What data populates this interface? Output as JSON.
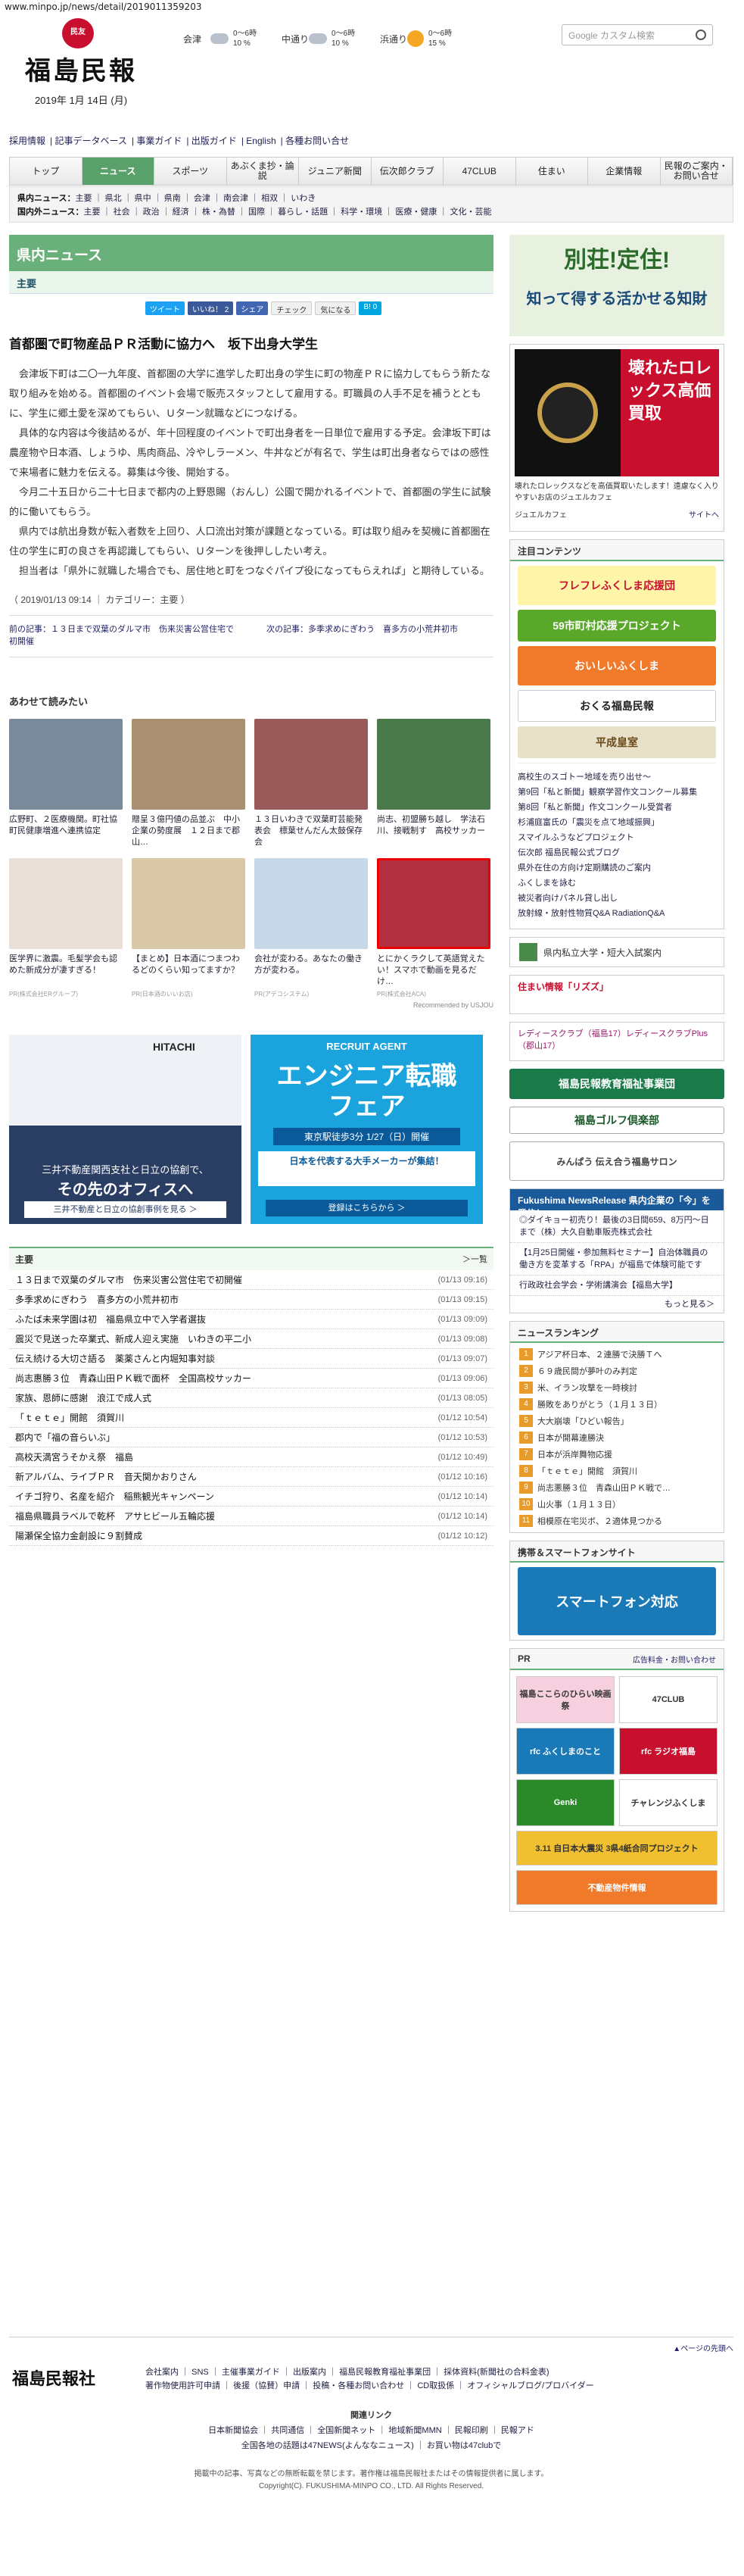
{
  "url": "www.minpo.jp/news/detail/2019011359203",
  "logo": {
    "seal": "民友",
    "name": "福島民報",
    "date": "2019年 1月 14日 (月)"
  },
  "weather": [
    {
      "city": "会津",
      "r1": "0〜6時",
      "p1": "10 %",
      "icon": "cloud"
    },
    {
      "city": "中通り",
      "r1": "0〜6時",
      "p1": "10 %",
      "icon": "cloud"
    },
    {
      "city": "浜通り",
      "r1": "0〜6時",
      "p1": "15 %",
      "icon": "sun"
    }
  ],
  "search": {
    "placeholder": "Google カスタム検索"
  },
  "topnav": [
    "採用情報",
    "記事データベース",
    "事業ガイド",
    "出版ガイド",
    "English",
    "各種お問い合せ"
  ],
  "gnav": [
    "トップ",
    "ニュース",
    "スポーツ",
    "あぶくま抄・論説",
    "ジュニア新聞",
    "伝次郎クラブ",
    "47CLUB",
    "住まい",
    "企業情報",
    "民報のご案内・お問い合せ"
  ],
  "subnav": {
    "l1_label": "県内ニュース：",
    "l1": "主要 ｜ 県北 ｜ 県中 ｜ 県南 ｜ 会津 ｜ 南会津 ｜ 相双 ｜ いわき",
    "l2_label": "国内外ニュース：",
    "l2": "主要 ｜ 社会 ｜ 政治 ｜ 経済 ｜ 株・為替 ｜ 国際 ｜ 暮らし・話題 ｜ 科学・環境 ｜ 医療・健康 ｜ 文化・芸能"
  },
  "main": {
    "section": "県内ニュース",
    "subsection": "主要",
    "social": [
      "ツイート",
      "いいね！ 2",
      "シェア",
      "チェック",
      "気になる",
      "B! 0"
    ],
    "title": "首都圏で町物産品ＰＲ活動に協力へ　坂下出身大学生",
    "paragraphs": [
      "会津坂下町は二〇一九年度、首都圏の大学に進学した町出身の学生に町の物産ＰＲに協力してもらう新たな取り組みを始める。首都圏のイベント会場で販売スタッフとして雇用する。町職員の人手不足を補うとともに、学生に郷土愛を深めてもらい、Ｕターン就職などにつなげる。",
      "具体的な内容は今後詰めるが、年十回程度のイベントで町出身者を一日単位で雇用する予定。会津坂下町は農産物や日本酒、しょうゆ、馬肉商品、冷やしラーメン、牛丼などが有名で、学生は町出身者ならではの感性で来場者に魅力を伝える。募集は今後、開始する。",
      "今月二十五日から二十七日まで都内の上野恩賜（おんし）公園で開かれるイベントで、首都圏の学生に試験的に働いてもらう。",
      "県内では航出身数が転入者数を上回り、人口流出対策が課題となっている。町は取り組みを契機に首都圏在住の学生に町の良さを再認識してもらい、Ｕターンを後押ししたい考え。",
      "担当者は「県外に就職した場合でも、居住地と町をつなぐパイプ役になってもらえれば」と期待している。"
    ],
    "meta": "（ 2019/01/13 09:14 ｜ カテゴリー：主要 ）",
    "prev": "前の記事：１３日まで双葉のダルマ市　伤来災害公営住宅で初開催",
    "next": "次の記事：多季求めにぎわう　喜多方の小荒井初市",
    "related_title": "あわせて読みたい",
    "related": [
      {
        "cap": "広野町、２医療機関。町社協　町民健康増進へ連携協定",
        "src": "",
        "c": "#7a8a9a"
      },
      {
        "cap": "贈呈３億円値の品並ぶ　中小企業の勢度展　１２日まで郡山…",
        "src": "",
        "c": "#a89070"
      },
      {
        "cap": "１３日いわきで双葉町芸能発表会　標葉せんだん太鼓保存会",
        "src": "",
        "c": "#9a5a5a"
      },
      {
        "cap": "尚志、初盟勝ち越し　学法石川、接戦制す　高校サッカー",
        "src": "",
        "c": "#4a7a4a"
      },
      {
        "cap": "医学界に激震。毛髪学会も認めた新成分が凄すぎる！",
        "src": "PR(株式会社ERグループ)",
        "c": "#e8e0d8"
      },
      {
        "cap": "【まとめ】日本酒につまつわるどのくらい知ってますか？",
        "src": "PR(日本酒のいいお店)",
        "c": "#d8c8a8"
      },
      {
        "cap": "会社が変わる。あなたの働き方が変わる。",
        "src": "PR(アデコシステム)",
        "c": "#c8d8e8"
      },
      {
        "cap": "とにかくラクして英語覚えたい！スマホで動画を見るだけ…",
        "src": "PR(株式会社ACA)",
        "c": "#b03040"
      }
    ],
    "recommended": "Recommended by USJOU",
    "ad1_top": "HITACHI",
    "ad1_line1": "三井不動産関西支社と日立の協創で、",
    "ad1_line2": "その先のオフィスへ",
    "ad1_btn": "三井不動産と日立の協創事例を見る ＞",
    "ad2_top": "RECRUIT AGENT",
    "ad2_big": "エンジニア転職フェア",
    "ad2_date": "東京駅徒歩3分 1/27（日）開催",
    "ad2_sub": "日本を代表する大手メーカーが集結！",
    "ad2_btn": "登録はこちらから ＞",
    "list_title": "主要",
    "list_more": "＞一覧",
    "list": [
      [
        "１３日まで双葉のダルマ市　伤来災害公営住宅で初開催",
        "(01/13 09:16)"
      ],
      [
        "多季求めにぎわう　喜多方の小荒井初市",
        "(01/13 09:15)"
      ],
      [
        "ふたば未来学園は初　福島県立中で入学者選抜",
        "(01/13 09:09)"
      ],
      [
        "震災で見送った卒業式、新成人迎え実施　いわきの平二小",
        "(01/13 09:08)"
      ],
      [
        "伝え続ける大切さ語る　薬薬さんと内堀知事対談",
        "(01/13 09:07)"
      ],
      [
        "尚志惠勝３位　青森山田ＰＫ戦で面杯　全国高校サッカー",
        "(01/13 09:06)"
      ],
      [
        "家族、恩師に感謝　浪江で成人式",
        "(01/13 08:05)"
      ],
      [
        "「ｔｅｔｅ」開館　須賀川",
        "(01/12 10:54)"
      ],
      [
        "郡内で「福の音らいぶ」",
        "(01/12 10:53)"
      ],
      [
        "高校天満宮うそかえ祭　福島",
        "(01/12 10:49)"
      ],
      [
        "新アルバム、ライブＰＲ　音天関かおりさん",
        "(01/12 10:16)"
      ],
      [
        "イチゴ狩り、名産を紹介　稲熊観光キャンペーン",
        "(01/12 10:14)"
      ],
      [
        "福島県職員ラベルで乾杯　アサヒビール五輪応援",
        "(01/12 10:14)"
      ],
      [
        "陽瀬保全協力金創設に９割賛成",
        "(01/12 10:12)"
      ]
    ]
  },
  "side": {
    "ad_top": "別荘!定住!",
    "ad_sub": "知って得する活かせる知財",
    "watch_caption": "壊れたロレックスなどを高価買取いたします！遠慮なく入りやすいお店のジュエルカフェ",
    "watch_brand": "ジュエルカフェ",
    "watch_link": "サイトへ",
    "watch_headline": "壊れたロレックス高価買取",
    "content_title": "注目コンテンツ",
    "banners": [
      "フレフレふくしま応援団",
      "59市町村応援プロジェクト",
      "おいしいふくしま",
      "おくる福島民報",
      "平成皇室"
    ],
    "news_items": [
      "高校生のスゴトー地域を売り出せ～",
      "第9回「私と新聞」観察学習作文コンクール募集",
      "第8回「私と新聞」作文コンクール受賞者",
      "杉浦庭富氏の「震災を点て地域振興」",
      "スマイルふうなどプロジェクト",
      "伝次郎 福島民報公式ブログ",
      "県外在住の方向け定期購読のご案内",
      "ふくしまを詠む",
      "被災者向けパネル貸し出し",
      "放射線・放射性物質Q&A RadiationQ&A"
    ],
    "school": "県内私立大学・短大入試案内",
    "housing": "住まい情報「リズズ」",
    "ladies": "レディースクラブ（福島17）レディースクラブPlus（郡山17）",
    "edu": "福島民報教育福祉事業団",
    "golf": "福島ゴルフ倶楽部",
    "salon": "みんぱう 伝え合う福島サロン",
    "release_title": "Fukushima NewsRelease 県内企業の「今」を発信！",
    "releases": [
      "◎ダイキョー初売り！最後の3日間659、8万円～日まで（株）大久自動車販売株式会社",
      "【1月25日開催・参加無料セミナー】自治体職員の働き方を変革する「RPA」が福島で体験可能です",
      "行政政社会学会・学術講演会【福島大学】"
    ],
    "release_more": "もっと見る＞",
    "ranking_title": "ニュースランキング",
    "ranking": [
      "アジア杯日本、２連勝で決勝Ｔへ",
      "６９歳民間が夢叶のみ判定",
      "米、イラン攻撃を一時検討",
      "勝敗をありがとう（１月１３日）",
      "大大崩壊「ひどい報告」",
      "日本が開幕連勝決",
      "日本が浜岸舞物応援",
      "「ｔｅｔｅ」開館　須賀川",
      "尚志悪勝３位　青森山田ＰＫ戦で…",
      "山火事（１月１３日）",
      "相模原在宅災ボ、２適体見つかる"
    ],
    "mobile_title": "携帯＆スマートフォンサイト",
    "mobile_banner": "スマートフォン対応",
    "pr_title": "PR",
    "pr_link": "広告料金・お問い合わせ",
    "pr_banners": [
      "福島ここらのひらい映画祭",
      "47CLUB",
      "rfc ふくしまのこと",
      "rfc ラジオ福島",
      "Genki",
      "チャレンジふくしま",
      "3.11 自日本大震災 3県4紙合同プロジェクト",
      "不動産物件情報"
    ]
  },
  "footer": {
    "top_link": "▲ページの先頭へ",
    "logo": "福島民報社",
    "links1": "会社案内 ｜ SNS ｜ 主催事業ガイド ｜ 出版案内 ｜ 福島民報教育福祉事業団 ｜ 採体資料(新聞社の合料金表)",
    "links2": "著作物使用許可申請 ｜ 後援（協賛）申請 ｜ 投稿・各種お問い合わせ ｜ CD取扱係 ｜ オフィシャルブログ/プロバイダー",
    "rel_title": "関連リンク",
    "rel1": "日本新聞協会 ｜ 共同通信 ｜ 全国新聞ネット ｜ 地域新聞MMN ｜ 民報印刷 ｜ 民報アド",
    "rel2": "全国各地の話題は47NEWS(よんななニュース) ｜ お買い物は47clubで",
    "copy1": "掲載中の記事、写真などの無断転載を禁じます。著作権は福島民報社またはその情報提供者に属します。",
    "copy2": "Copyright(C). FUKUSHIMA-MINPO CO., LTD. All Rights Reserved."
  },
  "colors": {
    "green": "#6ab07a",
    "red": "#c8102e"
  }
}
